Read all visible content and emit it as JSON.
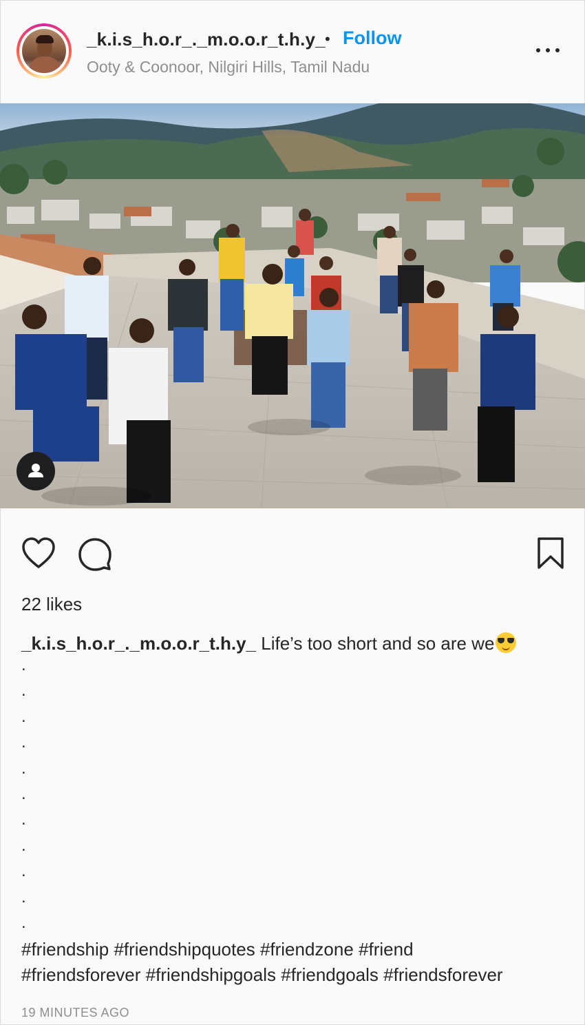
{
  "post": {
    "username": "_k.i.s_h.o.r_._m.o.o.r_t.h.y_",
    "separator": "•",
    "follow_label": "Follow",
    "location": "Ooty & Coonoor, Nilgiri Hills, Tamil Nadu",
    "likes_text": "22 likes",
    "caption_user": "_k.i.s_h.o.r_._m.o.o.r_t.h.y_",
    "caption_text": " Life’s too short and so are we",
    "caption_emoji": "smiling-face-with-sunglasses",
    "caption_dots": [
      ".",
      ".",
      ".",
      ".",
      ".",
      ".",
      ".",
      ".",
      ".",
      ".",
      "."
    ],
    "hashtags_line1": [
      "#friendship",
      "#friendshipquotes",
      "#friendzone",
      "#friend"
    ],
    "hashtags_line2": [
      "#friendsforever",
      "#friendshipgoals",
      "#friendgoals",
      "#friendsforever"
    ],
    "timestamp": "19 MINUTES AGO"
  },
  "icons": {
    "like": "heart-icon",
    "comment": "comment-icon",
    "save": "bookmark-icon",
    "more": "more-options-icon",
    "tagged": "user-tag-icon"
  },
  "colors": {
    "accent": "#0095f6",
    "text": "#262626",
    "secondary": "#8e8e8e",
    "background": "#fafafa"
  }
}
